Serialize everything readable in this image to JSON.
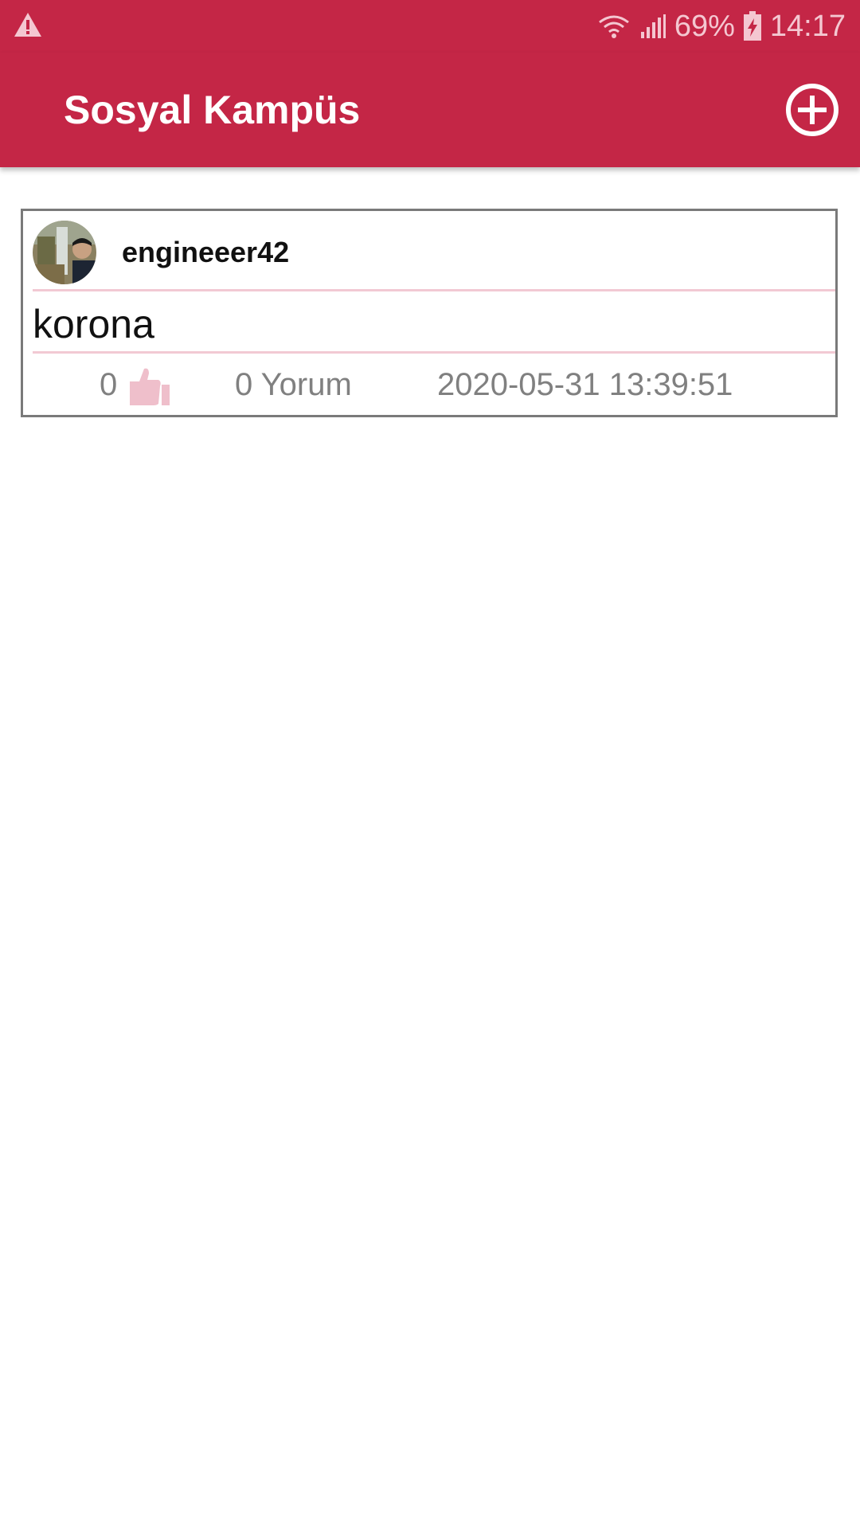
{
  "status_bar": {
    "warning_icon": "warning-triangle-icon",
    "wifi_icon": "wifi-icon",
    "signal_icon": "signal-icon",
    "battery_percent": "69%",
    "battery_icon": "battery-charging-icon",
    "time": "14:17"
  },
  "app_bar": {
    "title": "Sosyal Kampüs",
    "add_icon": "add-circle-icon"
  },
  "posts": [
    {
      "username": "engineeer42",
      "text": "korona",
      "likes": "0",
      "like_icon": "thumbs-up-icon",
      "comments": "0 Yorum",
      "date": "2020-05-31 13:39:51"
    }
  ],
  "colors": {
    "primary": "#c42646",
    "accent_light": "#f2c9d3",
    "muted_text": "#808080"
  }
}
